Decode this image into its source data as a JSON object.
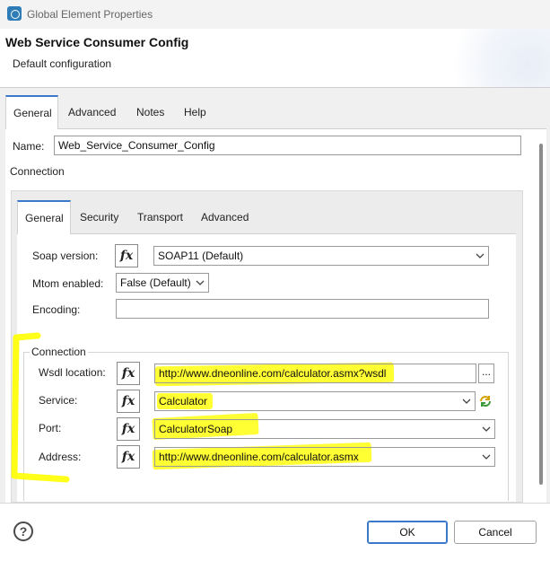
{
  "window": {
    "title": "Global Element Properties"
  },
  "header": {
    "title": "Web Service Consumer Config",
    "subtitle": "Default configuration"
  },
  "tabs": [
    "General",
    "Advanced",
    "Notes",
    "Help"
  ],
  "name_field": {
    "label": "Name:",
    "value": "Web_Service_Consumer_Config"
  },
  "connection_section": {
    "label": "Connection"
  },
  "inner_tabs": [
    "General",
    "Security",
    "Transport",
    "Advanced"
  ],
  "fx_symbol": "fx",
  "fields": {
    "soap_version": {
      "label": "Soap version:",
      "value": "SOAP11 (Default)"
    },
    "mtom_enabled": {
      "label": "Mtom enabled:",
      "value": "False (Default)"
    },
    "encoding": {
      "label": "Encoding:",
      "value": ""
    }
  },
  "connection_group": {
    "legend": "Connection",
    "wsdl_location": {
      "label": "Wsdl location:",
      "value": "http://www.dneonline.com/calculator.asmx?wsdl",
      "browse_label": "..."
    },
    "service": {
      "label": "Service:",
      "value": "Calculator"
    },
    "port": {
      "label": "Port:",
      "value": "CalculatorSoap"
    },
    "address": {
      "label": "Address:",
      "value": "http://www.dneonline.com/calculator.asmx"
    }
  },
  "footer": {
    "help_symbol": "?",
    "ok_label": "OK",
    "cancel_label": "Cancel"
  },
  "colors": {
    "accent": "#3a78c9",
    "highlight": "#ffff00"
  },
  "icons": [
    "app-icon",
    "fx-icon",
    "chevron-down-icon",
    "ellipsis-icon",
    "refresh-icon",
    "help-icon"
  ]
}
